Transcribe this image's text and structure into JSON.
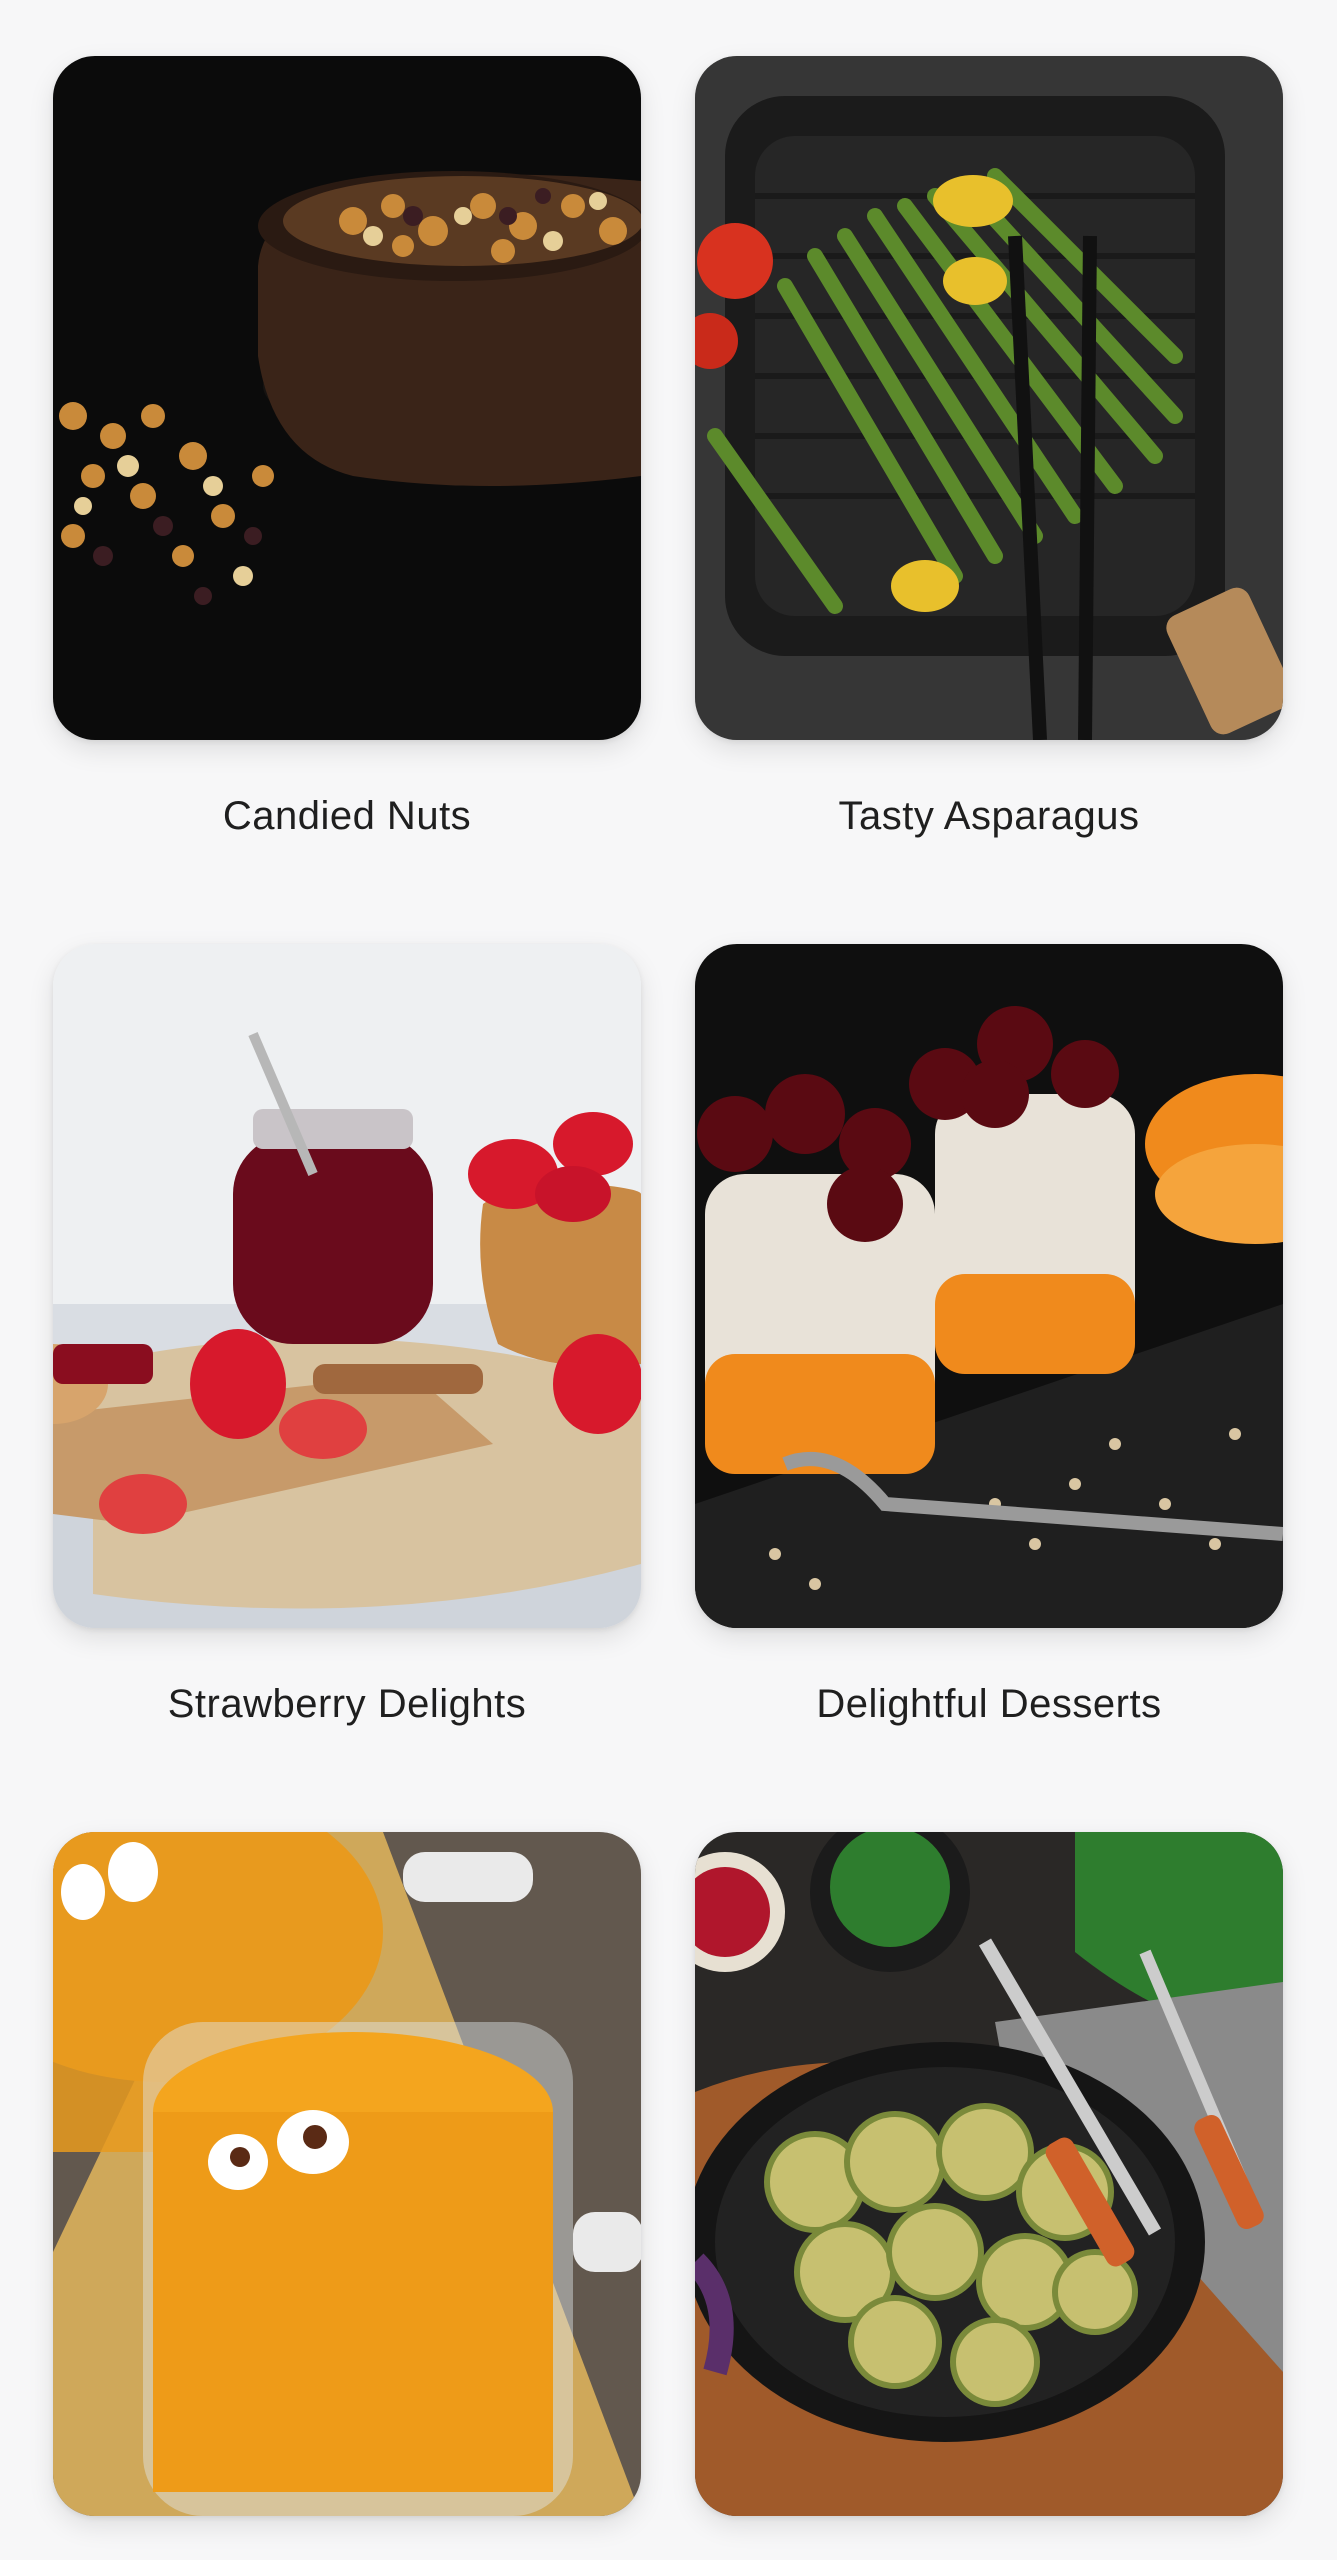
{
  "recipes": [
    {
      "title": "Candied Nuts",
      "image": "candied-nuts-photo"
    },
    {
      "title": "Tasty Asparagus",
      "image": "grilled-asparagus-photo"
    },
    {
      "title": "Strawberry Delights",
      "image": "strawberry-jam-photo"
    },
    {
      "title": "Delightful Desserts",
      "image": "cherry-chia-pudding-photo"
    },
    {
      "title": "",
      "image": "pumpkin-soup-photo"
    },
    {
      "title": "",
      "image": "fried-zucchini-photo"
    }
  ],
  "colors": {
    "background": "#f7f7f8",
    "label": "#1f1f1f"
  }
}
